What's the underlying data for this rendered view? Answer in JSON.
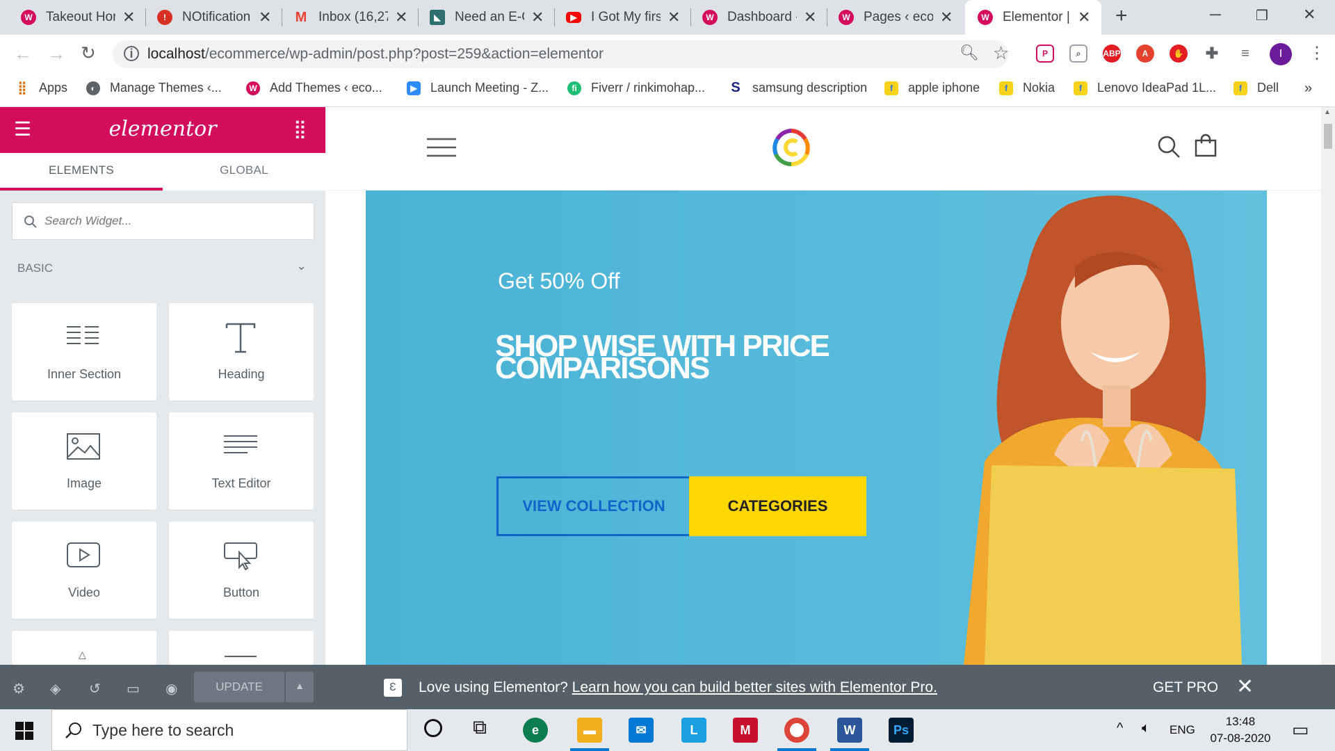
{
  "browser": {
    "tabs": [
      {
        "title": "Takeout Hom",
        "favicon_color": "#d30c5c"
      },
      {
        "title": "NOtification",
        "favicon_color": "#d93025"
      },
      {
        "title": "Inbox (16,27",
        "favicon_color": "#ea4335"
      },
      {
        "title": "Need an E-C",
        "favicon_color": "#2f6f6f"
      },
      {
        "title": "I Got My firs",
        "favicon_color": "#ff0000"
      },
      {
        "title": "Dashboard ‹",
        "favicon_color": "#d30c5c"
      },
      {
        "title": "Pages ‹ econ",
        "favicon_color": "#d30c5c"
      },
      {
        "title": "Elementor | E",
        "favicon_color": "#d30c5c",
        "active": true
      }
    ],
    "url_host": "localhost",
    "url_path": "/ecommerce/wp-admin/post.php?post=259&action=elementor",
    "profile_initial": "I",
    "extensions": [
      "pocket-icon",
      "screenshot-icon",
      "abp-icon",
      "adobe-icon",
      "stop-icon",
      "puzzle-icon",
      "media-icon"
    ],
    "bookmarks": [
      {
        "label": "Apps",
        "icon": "apps-grid-icon",
        "color": "#e8710a"
      },
      {
        "label": "Manage Themes ‹...",
        "icon": "globe-icon",
        "color": "#5f6368"
      },
      {
        "label": "Add Themes ‹ eco...",
        "icon": "site-icon",
        "color": "#d30c5c"
      },
      {
        "label": "Launch Meeting - Z...",
        "icon": "zoom-icon",
        "color": "#2d8cff"
      },
      {
        "label": "Fiverr / rinkimohap...",
        "icon": "fiverr-icon",
        "color": "#1dbf73"
      },
      {
        "label": "samsung description",
        "icon": "s-icon",
        "color": "#1a237e"
      },
      {
        "label": "apple iphone",
        "icon": "flipkart-icon",
        "color": "#f7d21b"
      },
      {
        "label": "Nokia",
        "icon": "flipkart-icon",
        "color": "#f7d21b"
      },
      {
        "label": "Lenovo IdeaPad 1L...",
        "icon": "flipkart-icon",
        "color": "#f7d21b"
      },
      {
        "label": "Dell",
        "icon": "flipkart-icon",
        "color": "#f7d21b"
      }
    ],
    "more_bookmarks": "»"
  },
  "panel": {
    "logo": "elementor",
    "tabs": [
      "ELEMENTS",
      "GLOBAL"
    ],
    "search_placeholder": "Search Widget...",
    "category": "BASIC",
    "widgets": [
      "Inner Section",
      "Heading",
      "Image",
      "Text Editor",
      "Video",
      "Button"
    ],
    "update_label": "UPDATE"
  },
  "promo": {
    "text": "Love using Elementor?",
    "link": "Learn how you can build better sites with Elementor Pro.",
    "get_pro": "GET PRO"
  },
  "hero": {
    "subtitle": "Get 50% Off",
    "title": "SHOP WISE WITH PRICE COMPARISONS",
    "button_primary": "VIEW COLLECTION",
    "button_secondary": "CATEGORIES",
    "accent_blue": "#0e66c8",
    "accent_yellow": "#fed700"
  },
  "taskbar": {
    "search_placeholder": "Type here to search",
    "language": "ENG",
    "time": "13:48",
    "date": "07-08-2020"
  },
  "colors": {
    "elementor_pink": "#d30c5c",
    "panel_bg": "#e6e9ec",
    "footer_bg": "#556068"
  }
}
